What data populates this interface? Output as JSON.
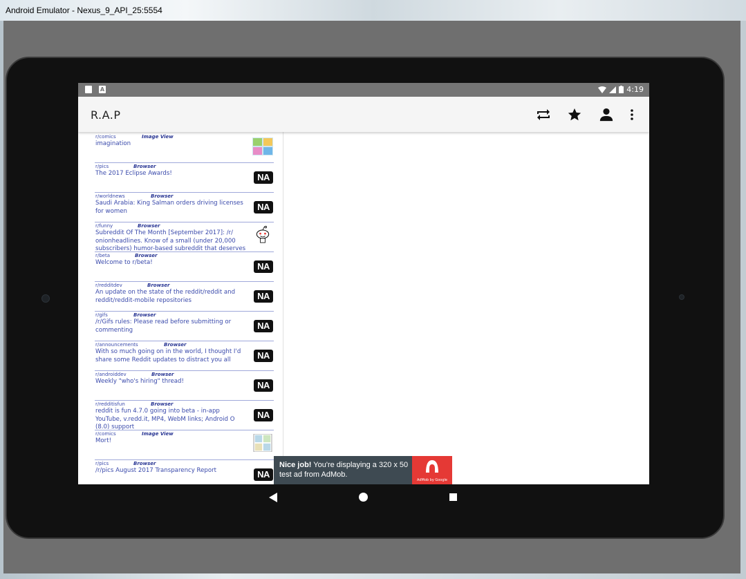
{
  "window": {
    "title": "Android Emulator - Nexus_9_API_25:5554"
  },
  "statusbar": {
    "time": "4:19",
    "left_icons": [
      "sd-card-icon",
      "a-notification-icon"
    ],
    "right_icons": [
      "wifi-icon",
      "signal-icon",
      "battery-icon"
    ]
  },
  "appbar": {
    "title": "R.A.P",
    "actions": [
      {
        "name": "repeat-icon",
        "label": "refresh"
      },
      {
        "name": "star-icon",
        "label": "favorites"
      },
      {
        "name": "person-icon",
        "label": "account"
      },
      {
        "name": "overflow-menu-icon",
        "label": "more"
      }
    ]
  },
  "posts": [
    {
      "subreddit": "r/comics",
      "kind": "Image View",
      "title": "imagination",
      "thumb": "image"
    },
    {
      "subreddit": "r/pics",
      "kind": "Browser",
      "title": "The 2017 Eclipse Awards!",
      "thumb": "NA"
    },
    {
      "subreddit": "r/worldnews",
      "kind": "Browser",
      "title": "Saudi Arabia: King Salman orders driving licenses for women",
      "thumb": "NA"
    },
    {
      "subreddit": "r/funny",
      "kind": "Browser",
      "title": "Subreddit Of The Month [September 2017]: /r/ onionheadlines. Know of a small (under 20,000 subscribers) humor-based subreddit that deserves a",
      "thumb": "reddit"
    },
    {
      "subreddit": "r/beta",
      "kind": "Browser",
      "title": "Welcome to r/beta!",
      "thumb": "NA"
    },
    {
      "subreddit": "r/redditdev",
      "kind": "Browser",
      "title": "An update on the state of the reddit/reddit and reddit/reddit-mobile repositories",
      "thumb": "NA"
    },
    {
      "subreddit": "r/gifs",
      "kind": "Browser",
      "title": "/r/Gifs rules: Please read before submitting or commenting",
      "thumb": "NA"
    },
    {
      "subreddit": "r/announcements",
      "kind": "Browser",
      "title": "With so much going on in the world, I thought I'd share some Reddit updates to distract you all",
      "thumb": "NA"
    },
    {
      "subreddit": "r/androiddev",
      "kind": "Browser",
      "title": "Weekly \"who's hiring\" thread!",
      "thumb": "NA"
    },
    {
      "subreddit": "r/redditisfun",
      "kind": "Browser",
      "title": "reddit is fun 4.7.0 going into beta - in-app YouTube, v.redd.it, MP4, WebM links; Android O (8.0) support",
      "thumb": "NA"
    },
    {
      "subreddit": "r/comics",
      "kind": "Image View",
      "title": "Mort!",
      "thumb": "image"
    },
    {
      "subreddit": "r/pics",
      "kind": "Browser",
      "title": "/r/pics August 2017 Transparency Report",
      "thumb": "NA"
    }
  ],
  "na_label": "NA",
  "ad": {
    "bold": "Nice job!",
    "text": " You're displaying a 320 x 50 test ad from AdMob.",
    "logo_caption": "AdMob by Google"
  }
}
